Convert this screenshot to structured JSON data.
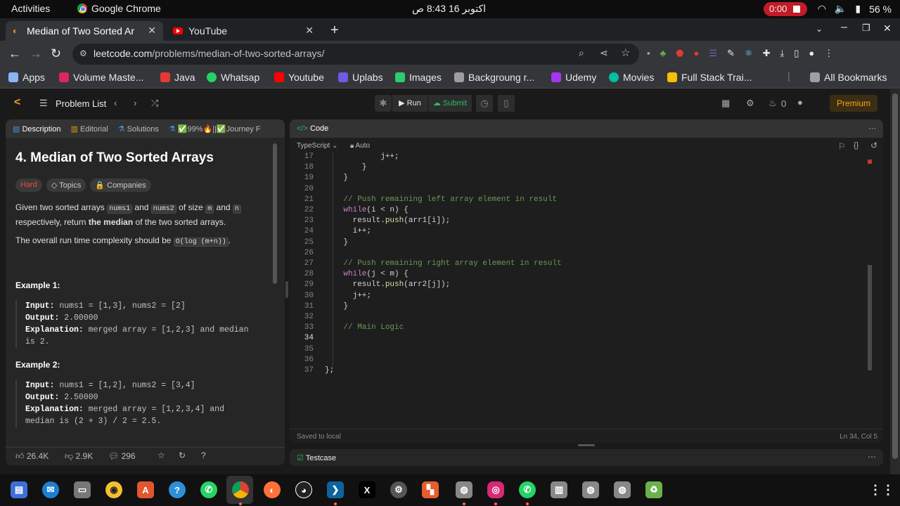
{
  "system": {
    "activities": "Activities",
    "app": "Google Chrome",
    "clock": "اكتوبر 16  8:43 ص",
    "recording": "0:00",
    "battery": "56 %"
  },
  "tabs": [
    {
      "title": "Median of Two Sorted Ar"
    },
    {
      "title": "YouTube"
    }
  ],
  "address": {
    "host": "leetcode.com",
    "path": "/problems/median-of-two-sorted-arrays/"
  },
  "bookmarks": [
    {
      "label": "Apps",
      "color": "#8ab4f8"
    },
    {
      "label": "Volume Maste...",
      "color": "#e0245e"
    },
    {
      "label": "Java",
      "color": "#e53935"
    },
    {
      "label": "Whatsap",
      "color": "#25d366"
    },
    {
      "label": "Youtube",
      "color": "#ff0000"
    },
    {
      "label": "Uplabs",
      "color": "#6c5ce7"
    },
    {
      "label": "Images",
      "color": "#2ecc71"
    },
    {
      "label": "Backgroung r...",
      "color": "#9e9e9e"
    },
    {
      "label": "Udemy",
      "color": "#a435f0"
    },
    {
      "label": "Movies",
      "color": "#00bfa5"
    },
    {
      "label": "Full Stack Trai...",
      "color": "#fbbc04"
    }
  ],
  "all_bookmarks": "All Bookmarks",
  "lc_nav": {
    "problem_list": "Problem List",
    "run": "Run",
    "submit": "Submit",
    "streak": "0",
    "premium": "Premium"
  },
  "left_tabs": [
    "Description",
    "Editorial",
    "Solutions",
    "✅99%🔥||✅Journey F"
  ],
  "problem": {
    "title": "4. Median of Two Sorted Arrays",
    "difficulty": "Hard",
    "topics": "Topics",
    "companies": "Companies",
    "p1_a": "Given two sorted arrays",
    "p1_nums1": "nums1",
    "p1_and": "and",
    "p1_nums2": "nums2",
    "p1_of_size": "of size",
    "p1_m": "m",
    "p1_and2": "and",
    "p1_n": "n",
    "p1_b": "respectively, return",
    "p1_bold": "the median",
    "p1_c": "of the two sorted arrays.",
    "p2_a": "The overall run time complexity should be",
    "p2_code": "O(log (m+n))",
    "p2_end": ".",
    "ex1_title": "Example 1:",
    "ex1": {
      "input_label": "Input:",
      "input": "nums1 = [1,3], nums2 = [2]",
      "output_label": "Output:",
      "output": "2.00000",
      "expl_label": "Explanation:",
      "expl": "merged array = [1,2,3] and median",
      "expl2": "is 2."
    },
    "ex2_title": "Example 2:",
    "ex2": {
      "input_label": "Input:",
      "input": "nums1 = [1,2], nums2 = [3,4]",
      "output_label": "Output:",
      "output": "2.50000",
      "expl_label": "Explanation:",
      "expl": "merged array = [1,2,3,4] and",
      "expl2": "median is (2 + 3) / 2 = 2.5."
    },
    "likes": "26.4K",
    "dislikes": "2.9K",
    "comments": "296"
  },
  "editor": {
    "title": "Code",
    "language": "TypeScript",
    "mode": "Auto",
    "status": "Saved to local",
    "cursor": "Ln 34, Col 5",
    "lines": [
      {
        "n": "17",
        "t": "            j++;"
      },
      {
        "n": "18",
        "t": "        }"
      },
      {
        "n": "19",
        "t": "    }"
      },
      {
        "n": "20",
        "t": ""
      },
      {
        "n": "21",
        "t": "    // Push remaining left array element in result"
      },
      {
        "n": "22",
        "t": "    while(i < n) {"
      },
      {
        "n": "23",
        "t": "      result.push(arr1[i]);"
      },
      {
        "n": "24",
        "t": "      i++;"
      },
      {
        "n": "25",
        "t": "    }"
      },
      {
        "n": "26",
        "t": ""
      },
      {
        "n": "27",
        "t": "    // Push remaining right array element in result"
      },
      {
        "n": "28",
        "t": "    while(j < m) {"
      },
      {
        "n": "29",
        "t": "      result.push(arr2[j]);"
      },
      {
        "n": "30",
        "t": "      j++;"
      },
      {
        "n": "31",
        "t": "    }"
      },
      {
        "n": "32",
        "t": ""
      },
      {
        "n": "33",
        "t": "    // Main Logic"
      },
      {
        "n": "34",
        "t": ""
      },
      {
        "n": "35",
        "t": ""
      },
      {
        "n": "36",
        "t": ""
      },
      {
        "n": "37",
        "t": "};"
      }
    ]
  },
  "testcase": "Testcase"
}
